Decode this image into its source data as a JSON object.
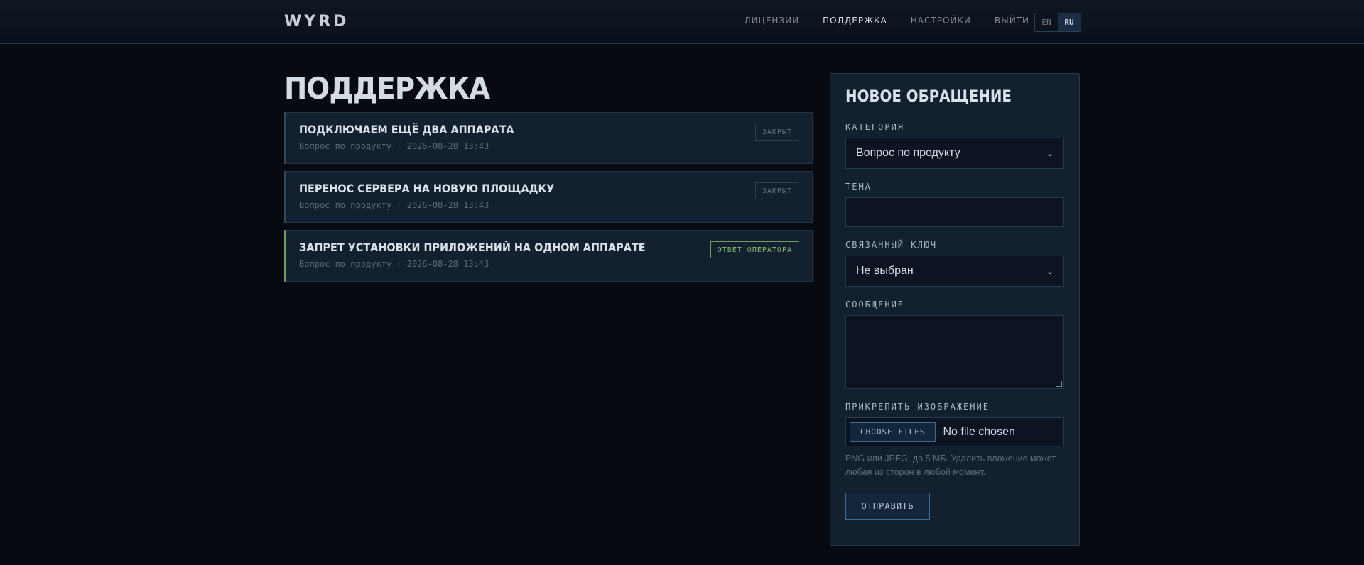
{
  "app": {
    "logo": "WYRD"
  },
  "nav": {
    "items": [
      {
        "label": "ЛИЦЕНЗИИ"
      },
      {
        "label": "ПОДДЕРЖКА"
      },
      {
        "label": "НАСТРОЙКИ"
      },
      {
        "label": "ВЫЙТИ"
      }
    ],
    "active": "ПОДДЕРЖКА",
    "lang": {
      "en": "EN",
      "ru": "RU",
      "selected": "RU"
    }
  },
  "page": {
    "title": "ПОДДЕРЖКА"
  },
  "tickets": [
    {
      "title": "ПОДКЛЮЧАЕМ ЕЩЁ ДВА АППАРАТА",
      "meta": "Вопрос по продукту · 2026-08-28 13:43",
      "status": "ЗАКРЫТ"
    },
    {
      "title": "ПЕРЕНОС СЕРВЕРА НА НОВУЮ ПЛОЩАДКУ",
      "meta": "Вопрос по продукту · 2026-08-28 13:43",
      "status": "ЗАКРЫТ"
    },
    {
      "title": "ЗАПРЕТ УСТАНОВКИ ПРИЛОЖЕНИЙ НА ОДНОМ АППАРАТЕ",
      "meta": "Вопрос по продукту · 2026-08-28 13:43",
      "status": "ОТВЕТ ОПЕРАТОРА"
    }
  ],
  "form": {
    "title": "НОВОЕ ОБРАЩЕНИЕ",
    "category": {
      "label": "КАТЕГОРИЯ",
      "value": "Вопрос по продукту"
    },
    "subject": {
      "label": "ТЕМА",
      "value": ""
    },
    "key": {
      "label": "СВЯЗАННЫЙ КЛЮЧ",
      "value": "Не выбран"
    },
    "message": {
      "label": "СООБЩЕНИЕ",
      "value": ""
    },
    "attach": {
      "label": "ПРИКРЕПИТЬ ИЗОБРАЖЕНИЕ",
      "button": "CHOOSE FILES",
      "status": "No file chosen",
      "hint": "PNG или JPEG, до 5 МБ. Удалить вложение может любая из сторон в любой момент."
    },
    "submit": "ОТПРАВИТЬ"
  },
  "colors": {
    "background": "#070b11",
    "panel": "#12202f",
    "accent": "#3d6a94",
    "answered": "#6fa05a"
  }
}
